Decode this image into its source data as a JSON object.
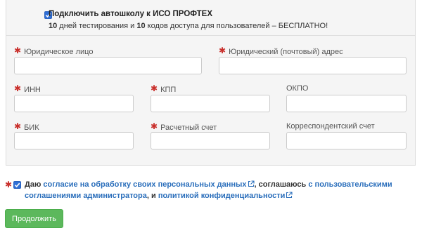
{
  "promo": {
    "title": "Подключить автошколу к ИСО ПРОФТЕХ",
    "num1": "10",
    "text1": " дней тестирования и ",
    "num2": "10",
    "text2": " кодов доступа для пользователей – БЕСПЛАТНО!"
  },
  "fields": {
    "legal_name": {
      "label": "Юридическое лицо",
      "value": "",
      "required": true
    },
    "legal_address": {
      "label": "Юридический (почтовый) адрес",
      "value": "",
      "required": true
    },
    "inn": {
      "label": "ИНН",
      "value": "",
      "required": true
    },
    "kpp": {
      "label": "КПП",
      "value": "",
      "required": true
    },
    "okpo": {
      "label": "ОКПО",
      "value": "",
      "required": false
    },
    "bik": {
      "label": "БИК",
      "value": "",
      "required": true
    },
    "account": {
      "label": "Расчетный счет",
      "value": "",
      "required": true
    },
    "corr_account": {
      "label": "Корреспондентский счет",
      "value": "",
      "required": false
    }
  },
  "consent": {
    "t1": "Даю ",
    "link1": "согласие на обработку своих персональных данных",
    "t2": ", соглашаюсь ",
    "link2": "с пользовательскими соглашениями администратора",
    "t3": ", и ",
    "link3": "политикой конфиденциальности"
  },
  "submit_label": "Продолжить",
  "colors": {
    "required_star": "#c9302c",
    "link": "#2a6ebb",
    "submit_bg": "#5cb85c",
    "checkbox": "#2f6fd6"
  },
  "icons": {
    "checkbox": "check-icon",
    "external_link": "external-link-icon"
  }
}
